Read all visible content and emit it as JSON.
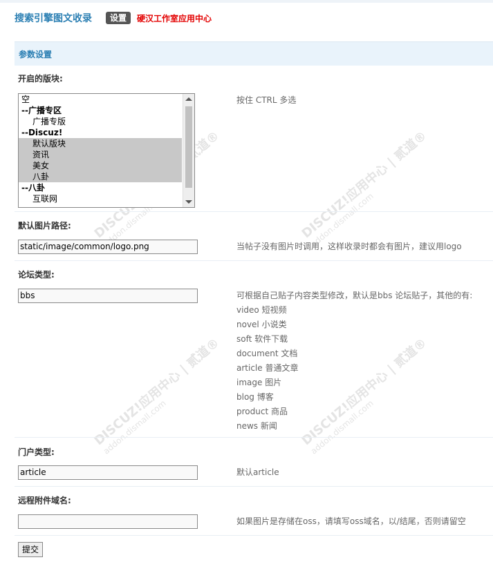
{
  "header": {
    "title": "搜索引擎图文收录",
    "badge": "设置",
    "studio": "硬汉工作室应用中心"
  },
  "section": {
    "title": "参数设置"
  },
  "fields": {
    "modules": {
      "label": "开启的版块:",
      "hint": "按住 CTRL 多选",
      "options": [
        "空",
        "--广播专区",
        "广播专版",
        "--Discuz!",
        "默认版块",
        "资讯",
        "美女",
        "八卦",
        "--八卦",
        "互联网"
      ]
    },
    "image_path": {
      "label": "默认图片路径:",
      "value": "static/image/common/logo.png",
      "hint": "当帖子没有图片时调用，这样收录时都会有图片，建议用logo"
    },
    "forum_type": {
      "label": "论坛类型:",
      "value": "bbs",
      "hint": [
        "可根据自己贴子内容类型修改，默认是bbs 论坛贴子，其他的有:",
        "video 短视频",
        "novel 小说类",
        "soft 软件下载",
        "document 文档",
        "article 普通文章",
        "image 图片",
        "blog 博客",
        "product 商品",
        "news 新闻"
      ]
    },
    "portal_type": {
      "label": "门户类型:",
      "value": "article",
      "hint": "默认article"
    },
    "remote_domain": {
      "label": "远程附件域名:",
      "value": "",
      "hint": "如果图片是存储在oss，请填写oss域名，以/结尾，否则请留空"
    }
  },
  "submit_label": "提交",
  "watermark": {
    "line1": "DISCUZ!应用中心 | 贰道®",
    "line2": "addon.dismall.com"
  }
}
